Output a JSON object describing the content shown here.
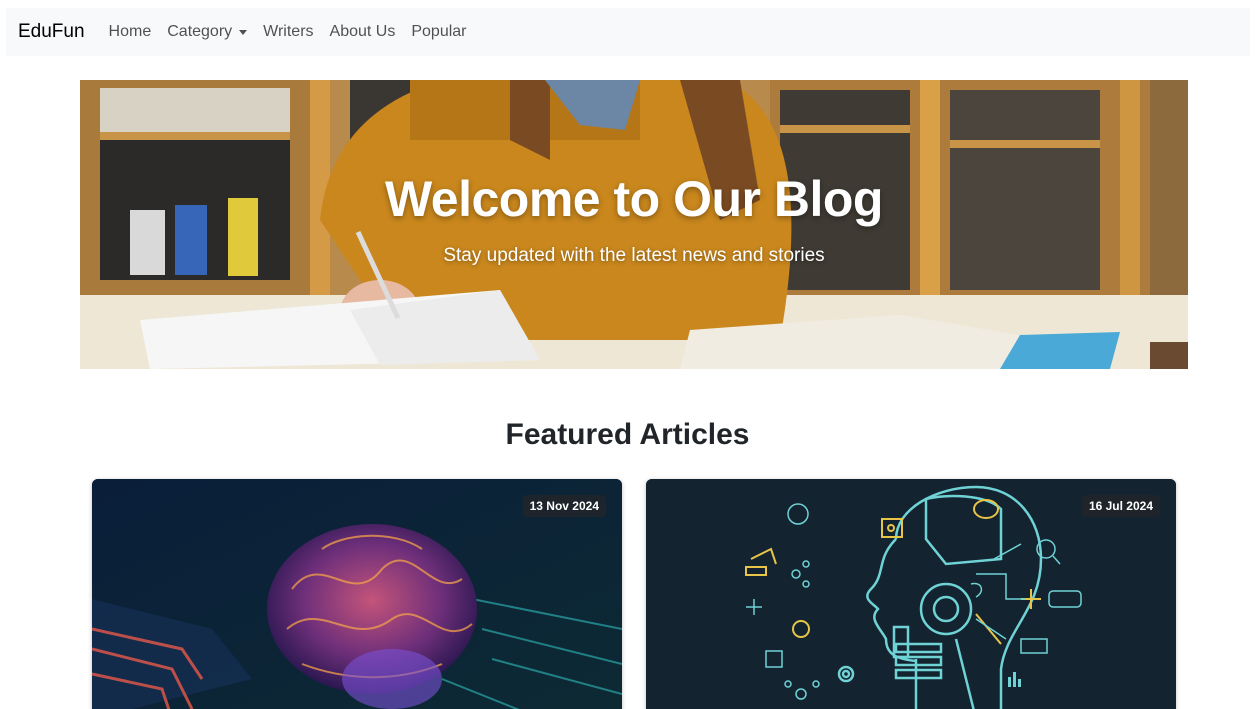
{
  "navbar": {
    "brand": "EduFun",
    "links": [
      {
        "label": "Home"
      },
      {
        "label": "Category",
        "dropdown": true
      },
      {
        "label": "Writers"
      },
      {
        "label": "About Us"
      },
      {
        "label": "Popular"
      }
    ]
  },
  "hero": {
    "title": "Welcome to Our Blog",
    "subtitle": "Stay updated with the latest news and stories"
  },
  "featured": {
    "title": "Featured Articles",
    "articles": [
      {
        "date": "13 Nov 2024"
      },
      {
        "date": "16 Jul 2024"
      }
    ]
  },
  "colors": {
    "navbar_bg": "#f8f9fa",
    "badge_bg": "#212529",
    "text": "#212529"
  }
}
